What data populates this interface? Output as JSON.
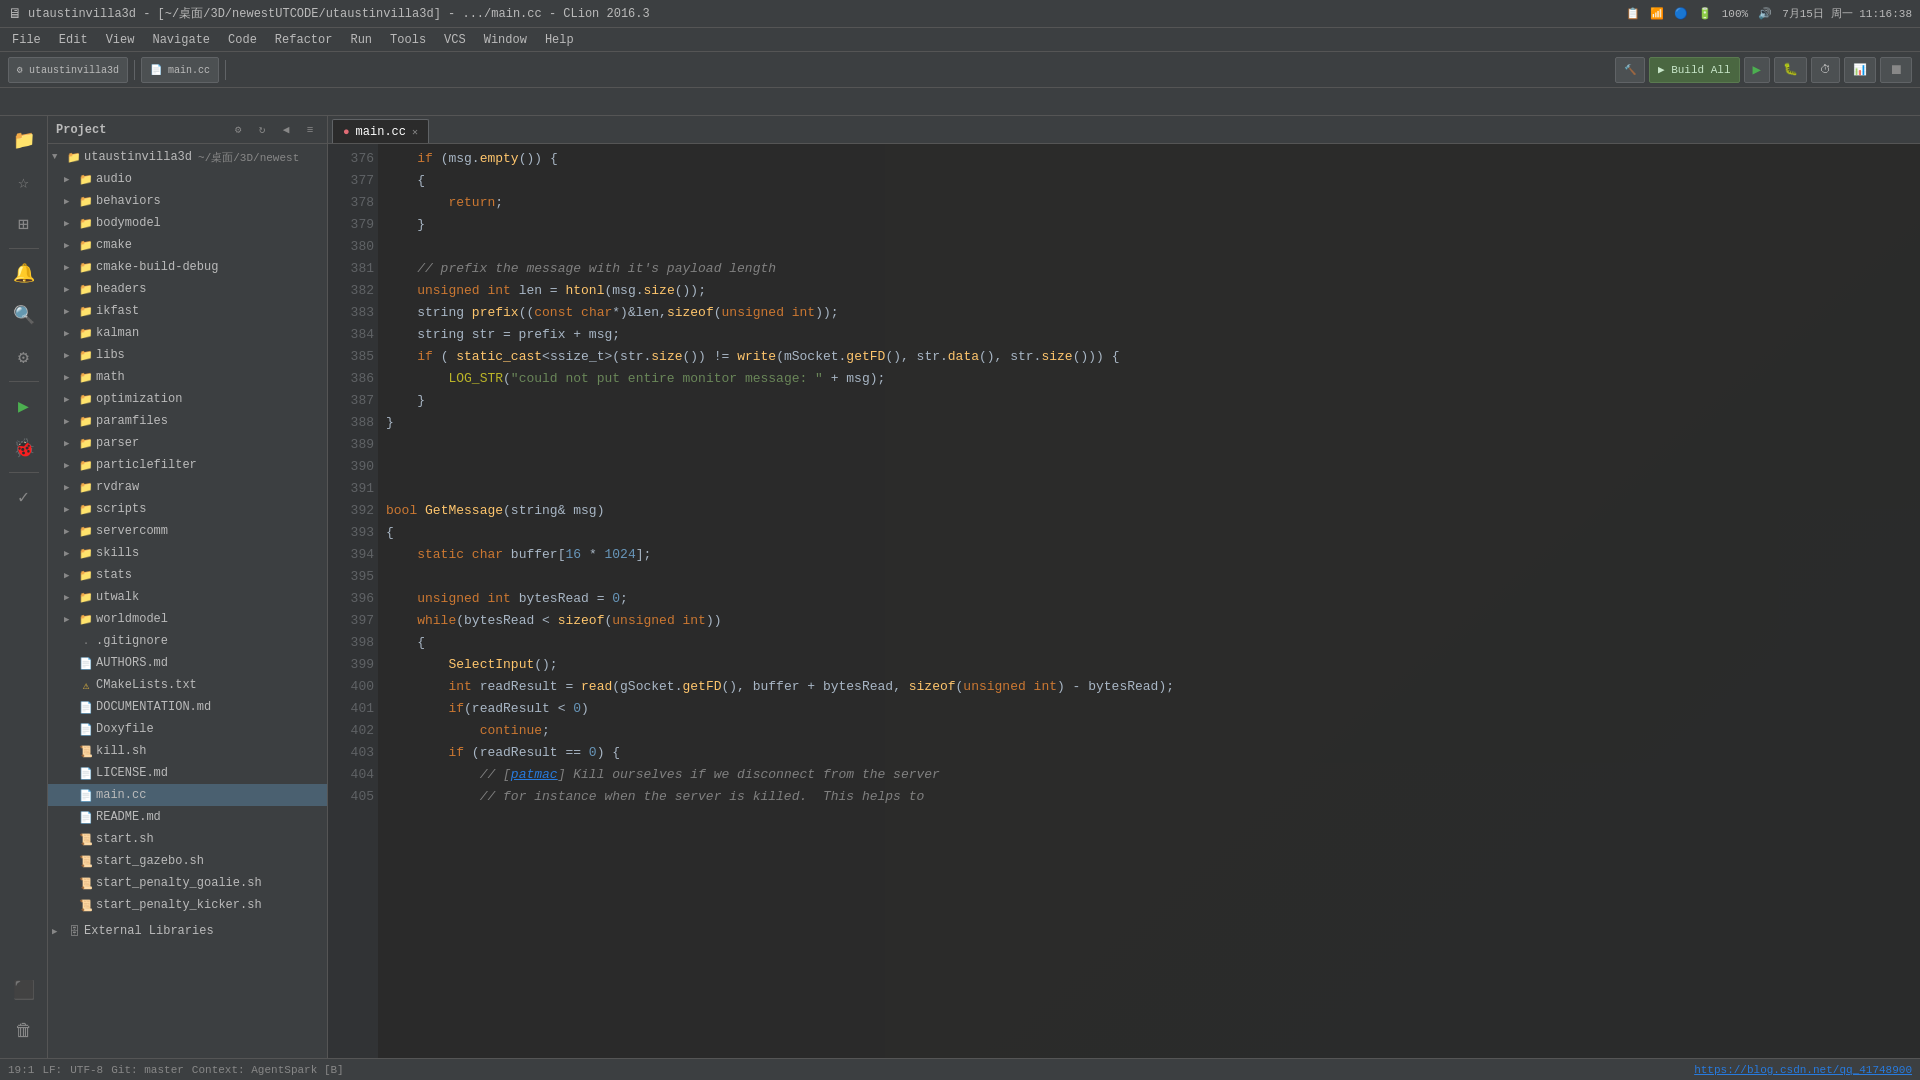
{
  "titleBar": {
    "title": "utaustinvilla3d - [~/桌面/3D/newestUTCODE/utaustinvilla3d] - .../main.cc - CLion 2016.3",
    "battery": "100%",
    "time": "7月15日 周一  11:16:38",
    "signal": "wifi",
    "bluetooth": "bt"
  },
  "menuBar": {
    "items": [
      "File",
      "Edit",
      "View",
      "Navigate",
      "Code",
      "Refactor",
      "Run",
      "Tools",
      "VCS",
      "Window",
      "Help"
    ]
  },
  "toolbar": {
    "buildLabel": "▶ Build All",
    "runLabel": "▶",
    "debugLabel": "🐛",
    "stopLabel": "⏹"
  },
  "tabs": [
    {
      "label": "main.cc",
      "active": true
    }
  ],
  "projectPanel": {
    "title": "Project",
    "rootLabel": "utaustinvilla3d",
    "rootPath": "~/桌面/3D/newest",
    "items": [
      {
        "indent": 1,
        "type": "folder",
        "label": "audio",
        "open": false
      },
      {
        "indent": 1,
        "type": "folder",
        "label": "behaviors",
        "open": false
      },
      {
        "indent": 1,
        "type": "folder",
        "label": "bodymodel",
        "open": false
      },
      {
        "indent": 1,
        "type": "folder",
        "label": "cmake",
        "open": false
      },
      {
        "indent": 1,
        "type": "folder",
        "label": "cmake-build-debug",
        "open": false
      },
      {
        "indent": 1,
        "type": "folder",
        "label": "headers",
        "open": false
      },
      {
        "indent": 1,
        "type": "folder",
        "label": "ikfast",
        "open": false
      },
      {
        "indent": 1,
        "type": "folder",
        "label": "kalman",
        "open": false
      },
      {
        "indent": 1,
        "type": "folder",
        "label": "libs",
        "open": false
      },
      {
        "indent": 1,
        "type": "folder",
        "label": "math",
        "open": false
      },
      {
        "indent": 1,
        "type": "folder",
        "label": "optimization",
        "open": false
      },
      {
        "indent": 1,
        "type": "folder",
        "label": "paramfiles",
        "open": false
      },
      {
        "indent": 1,
        "type": "folder",
        "label": "parser",
        "open": false
      },
      {
        "indent": 1,
        "type": "folder",
        "label": "particlefilter",
        "open": false
      },
      {
        "indent": 1,
        "type": "folder",
        "label": "rvdraw",
        "open": false
      },
      {
        "indent": 1,
        "type": "folder",
        "label": "scripts",
        "open": false
      },
      {
        "indent": 1,
        "type": "folder",
        "label": "servercomm",
        "open": false
      },
      {
        "indent": 1,
        "type": "folder",
        "label": "skills",
        "open": false
      },
      {
        "indent": 1,
        "type": "folder",
        "label": "stats",
        "open": false
      },
      {
        "indent": 1,
        "type": "folder",
        "label": "utwalk",
        "open": false
      },
      {
        "indent": 1,
        "type": "folder",
        "label": "worldmodel",
        "open": false
      },
      {
        "indent": 1,
        "type": "file-hidden",
        "label": ".gitignore"
      },
      {
        "indent": 1,
        "type": "file-md",
        "label": "AUTHORS.md"
      },
      {
        "indent": 1,
        "type": "file-cmake",
        "label": "CMakeLists.txt"
      },
      {
        "indent": 1,
        "type": "file",
        "label": "DOCUMENTATION.md"
      },
      {
        "indent": 1,
        "type": "file",
        "label": "Doxyfile"
      },
      {
        "indent": 1,
        "type": "file-sh",
        "label": "kill.sh"
      },
      {
        "indent": 1,
        "type": "file-md",
        "label": "LICENSE.md"
      },
      {
        "indent": 1,
        "type": "file-cc",
        "label": "main.cc"
      },
      {
        "indent": 1,
        "type": "file-md",
        "label": "README.md"
      },
      {
        "indent": 1,
        "type": "file-sh",
        "label": "start.sh"
      },
      {
        "indent": 1,
        "type": "file-sh",
        "label": "start_gazebo.sh"
      },
      {
        "indent": 1,
        "type": "file-sh",
        "label": "start_penalty_goalie.sh"
      },
      {
        "indent": 1,
        "type": "file-sh",
        "label": "start_penalty_kicker.sh"
      },
      {
        "indent": 0,
        "type": "folder-ext",
        "label": "External Libraries",
        "open": false
      }
    ]
  },
  "codeLines": [
    {
      "num": 376,
      "content": "    if (msg.empty())"
    },
    {
      "num": 377,
      "content": "    {"
    },
    {
      "num": 378,
      "content": "        return;"
    },
    {
      "num": 379,
      "content": "    }"
    },
    {
      "num": 380,
      "content": ""
    },
    {
      "num": 381,
      "content": "    // prefix the message with it's payload length"
    },
    {
      "num": 382,
      "content": "    unsigned int len = htonl(msg.size());"
    },
    {
      "num": 383,
      "content": "    string prefix((const char*)&len,sizeof(unsigned int));"
    },
    {
      "num": 384,
      "content": "    string str = prefix + msg;"
    },
    {
      "num": 385,
      "content": "    if ( static_cast<ssize_t>(str.size()) != write(mSocket.getFD(), str.data(), str.size())) {"
    },
    {
      "num": 386,
      "content": "        LOG_STR(\"could not put entire monitor message: \" + msg);"
    },
    {
      "num": 387,
      "content": "    }"
    },
    {
      "num": 388,
      "content": "}"
    },
    {
      "num": 389,
      "content": ""
    },
    {
      "num": 390,
      "content": ""
    },
    {
      "num": 391,
      "content": ""
    },
    {
      "num": 392,
      "content": "bool GetMessage(string& msg)"
    },
    {
      "num": 393,
      "content": "{"
    },
    {
      "num": 394,
      "content": "    static char buffer[16 * 1024];"
    },
    {
      "num": 395,
      "content": ""
    },
    {
      "num": 396,
      "content": "    unsigned int bytesRead = 0;"
    },
    {
      "num": 397,
      "content": "    while(bytesRead < sizeof(unsigned int))"
    },
    {
      "num": 398,
      "content": "    {"
    },
    {
      "num": 399,
      "content": "        SelectInput();"
    },
    {
      "num": 400,
      "content": "        int readResult = read(gSocket.getFD(), buffer + bytesRead, sizeof(unsigned int) - bytesRead);"
    },
    {
      "num": 401,
      "content": "        if(readResult < 0)"
    },
    {
      "num": 402,
      "content": "            continue;"
    },
    {
      "num": 403,
      "content": "        if (readResult == 0) {"
    },
    {
      "num": 404,
      "content": "            // [patmac] Kill ourselves if we disconnect from the server"
    },
    {
      "num": 405,
      "content": "            // for instance when the server is killed.  This helps to"
    }
  ],
  "statusBar": {
    "position": "19:1",
    "encoding": "UTF-8",
    "lineEnding": "Git: master",
    "link": "https://blog.csdn.net/qq_41748900",
    "context": "Context: AgentSpark [B]"
  },
  "sideIcons": [
    {
      "name": "project-icon",
      "symbol": "📁",
      "active": true
    },
    {
      "name": "favorites-icon",
      "symbol": "⭐",
      "active": false
    },
    {
      "name": "structure-icon",
      "symbol": "🔧",
      "active": false
    },
    {
      "name": "notifications-icon",
      "symbol": "🔔",
      "active": false
    },
    {
      "name": "search-icon",
      "symbol": "🔍",
      "active": false
    },
    {
      "name": "cmake-icon",
      "symbol": "⚙",
      "active": false
    },
    {
      "name": "run-icon",
      "symbol": "▶",
      "active": false
    },
    {
      "name": "debug-icon",
      "symbol": "🐛",
      "active": false
    },
    {
      "name": "todo-icon",
      "symbol": "✓",
      "active": false
    },
    {
      "name": "terminal-icon",
      "symbol": "⬛",
      "active": false
    },
    {
      "name": "trash-icon",
      "symbol": "🗑",
      "active": false
    }
  ]
}
